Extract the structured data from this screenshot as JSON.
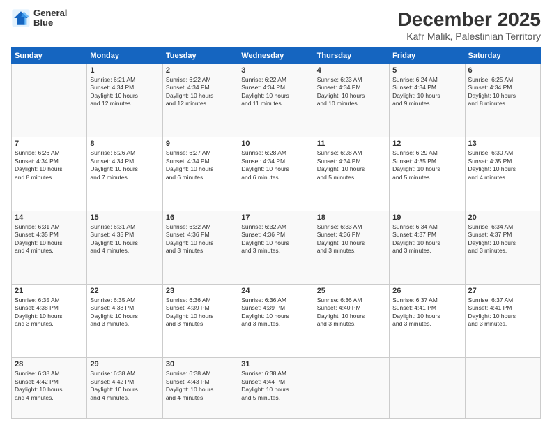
{
  "logo": {
    "line1": "General",
    "line2": "Blue"
  },
  "title": "December 2025",
  "subtitle": "Kafr Malik, Palestinian Territory",
  "days_of_week": [
    "Sunday",
    "Monday",
    "Tuesday",
    "Wednesday",
    "Thursday",
    "Friday",
    "Saturday"
  ],
  "weeks": [
    [
      {
        "day": "",
        "info": ""
      },
      {
        "day": "1",
        "info": "Sunrise: 6:21 AM\nSunset: 4:34 PM\nDaylight: 10 hours\nand 12 minutes."
      },
      {
        "day": "2",
        "info": "Sunrise: 6:22 AM\nSunset: 4:34 PM\nDaylight: 10 hours\nand 12 minutes."
      },
      {
        "day": "3",
        "info": "Sunrise: 6:22 AM\nSunset: 4:34 PM\nDaylight: 10 hours\nand 11 minutes."
      },
      {
        "day": "4",
        "info": "Sunrise: 6:23 AM\nSunset: 4:34 PM\nDaylight: 10 hours\nand 10 minutes."
      },
      {
        "day": "5",
        "info": "Sunrise: 6:24 AM\nSunset: 4:34 PM\nDaylight: 10 hours\nand 9 minutes."
      },
      {
        "day": "6",
        "info": "Sunrise: 6:25 AM\nSunset: 4:34 PM\nDaylight: 10 hours\nand 8 minutes."
      }
    ],
    [
      {
        "day": "7",
        "info": "Sunrise: 6:26 AM\nSunset: 4:34 PM\nDaylight: 10 hours\nand 8 minutes."
      },
      {
        "day": "8",
        "info": "Sunrise: 6:26 AM\nSunset: 4:34 PM\nDaylight: 10 hours\nand 7 minutes."
      },
      {
        "day": "9",
        "info": "Sunrise: 6:27 AM\nSunset: 4:34 PM\nDaylight: 10 hours\nand 6 minutes."
      },
      {
        "day": "10",
        "info": "Sunrise: 6:28 AM\nSunset: 4:34 PM\nDaylight: 10 hours\nand 6 minutes."
      },
      {
        "day": "11",
        "info": "Sunrise: 6:28 AM\nSunset: 4:34 PM\nDaylight: 10 hours\nand 5 minutes."
      },
      {
        "day": "12",
        "info": "Sunrise: 6:29 AM\nSunset: 4:35 PM\nDaylight: 10 hours\nand 5 minutes."
      },
      {
        "day": "13",
        "info": "Sunrise: 6:30 AM\nSunset: 4:35 PM\nDaylight: 10 hours\nand 4 minutes."
      }
    ],
    [
      {
        "day": "14",
        "info": "Sunrise: 6:31 AM\nSunset: 4:35 PM\nDaylight: 10 hours\nand 4 minutes."
      },
      {
        "day": "15",
        "info": "Sunrise: 6:31 AM\nSunset: 4:35 PM\nDaylight: 10 hours\nand 4 minutes."
      },
      {
        "day": "16",
        "info": "Sunrise: 6:32 AM\nSunset: 4:36 PM\nDaylight: 10 hours\nand 3 minutes."
      },
      {
        "day": "17",
        "info": "Sunrise: 6:32 AM\nSunset: 4:36 PM\nDaylight: 10 hours\nand 3 minutes."
      },
      {
        "day": "18",
        "info": "Sunrise: 6:33 AM\nSunset: 4:36 PM\nDaylight: 10 hours\nand 3 minutes."
      },
      {
        "day": "19",
        "info": "Sunrise: 6:34 AM\nSunset: 4:37 PM\nDaylight: 10 hours\nand 3 minutes."
      },
      {
        "day": "20",
        "info": "Sunrise: 6:34 AM\nSunset: 4:37 PM\nDaylight: 10 hours\nand 3 minutes."
      }
    ],
    [
      {
        "day": "21",
        "info": "Sunrise: 6:35 AM\nSunset: 4:38 PM\nDaylight: 10 hours\nand 3 minutes."
      },
      {
        "day": "22",
        "info": "Sunrise: 6:35 AM\nSunset: 4:38 PM\nDaylight: 10 hours\nand 3 minutes."
      },
      {
        "day": "23",
        "info": "Sunrise: 6:36 AM\nSunset: 4:39 PM\nDaylight: 10 hours\nand 3 minutes."
      },
      {
        "day": "24",
        "info": "Sunrise: 6:36 AM\nSunset: 4:39 PM\nDaylight: 10 hours\nand 3 minutes."
      },
      {
        "day": "25",
        "info": "Sunrise: 6:36 AM\nSunset: 4:40 PM\nDaylight: 10 hours\nand 3 minutes."
      },
      {
        "day": "26",
        "info": "Sunrise: 6:37 AM\nSunset: 4:41 PM\nDaylight: 10 hours\nand 3 minutes."
      },
      {
        "day": "27",
        "info": "Sunrise: 6:37 AM\nSunset: 4:41 PM\nDaylight: 10 hours\nand 3 minutes."
      }
    ],
    [
      {
        "day": "28",
        "info": "Sunrise: 6:38 AM\nSunset: 4:42 PM\nDaylight: 10 hours\nand 4 minutes."
      },
      {
        "day": "29",
        "info": "Sunrise: 6:38 AM\nSunset: 4:42 PM\nDaylight: 10 hours\nand 4 minutes."
      },
      {
        "day": "30",
        "info": "Sunrise: 6:38 AM\nSunset: 4:43 PM\nDaylight: 10 hours\nand 4 minutes."
      },
      {
        "day": "31",
        "info": "Sunrise: 6:38 AM\nSunset: 4:44 PM\nDaylight: 10 hours\nand 5 minutes."
      },
      {
        "day": "",
        "info": ""
      },
      {
        "day": "",
        "info": ""
      },
      {
        "day": "",
        "info": ""
      }
    ]
  ]
}
